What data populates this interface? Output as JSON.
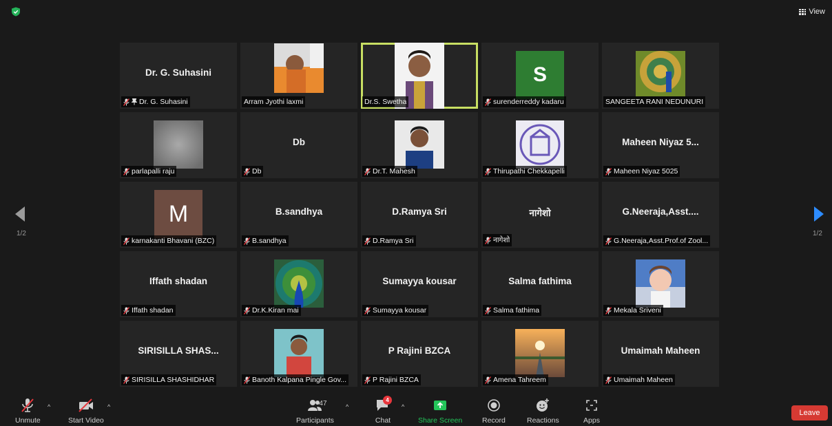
{
  "top": {
    "view_label": "View"
  },
  "colors": {
    "active_outline": "#c8df63",
    "leave": "#d63a33",
    "share": "#24c55a",
    "badge": "#e8373d"
  },
  "participants": [
    {
      "tile_name": "Dr. G. Suhasini",
      "label": "Dr. G. Suhasini",
      "muted": true,
      "pinned": true
    },
    {
      "label": "Arram Jyothi laxmi",
      "muted": false
    },
    {
      "label": "Dr.S. Swetha",
      "muted": false,
      "active_speaker": true
    },
    {
      "letter": "S",
      "label": "surenderreddy kadaru",
      "muted": true
    },
    {
      "label": "SANGEETA RANI NEDUNURI",
      "muted": false
    },
    {
      "label": "parlapalli raju",
      "muted": true
    },
    {
      "tile_name": "Db",
      "label": "Db",
      "muted": true
    },
    {
      "label": "Dr.T. Mahesh",
      "muted": true
    },
    {
      "label": "Thirupathi Chekkapelli",
      "muted": true
    },
    {
      "tile_name": "Maheen Niyaz 5...",
      "label": "Maheen Niyaz 5025",
      "muted": true
    },
    {
      "letter": "M",
      "label": "karnakanti Bhavani (BZC)",
      "muted": true
    },
    {
      "tile_name": "B.sandhya",
      "label": "B.sandhya",
      "muted": true
    },
    {
      "tile_name": "D.Ramya Sri",
      "label": "D.Ramya Sri",
      "muted": true
    },
    {
      "tile_name": "नागेशो",
      "label": "नागेशो",
      "muted": true
    },
    {
      "tile_name": "G.Neeraja,Asst....",
      "label": "G.Neeraja,Asst.Prof.of Zool...",
      "muted": true
    },
    {
      "tile_name": "Iffath shadan",
      "label": "Iffath shadan",
      "muted": true
    },
    {
      "label": "Dr.K.Kiran mai",
      "muted": true
    },
    {
      "tile_name": "Sumayya kousar",
      "label": "Sumayya kousar",
      "muted": true
    },
    {
      "tile_name": "Salma fathima",
      "label": "Salma fathima",
      "muted": true
    },
    {
      "label": "Mekala Sriveni",
      "muted": true
    },
    {
      "tile_name": "SIRISILLA SHAS...",
      "label": "SIRISILLA SHASHIDHAR",
      "muted": true
    },
    {
      "label": "Banoth Kalpana Pingle Gov...",
      "muted": true
    },
    {
      "tile_name": "P Rajini BZCA",
      "label": "P Rajini BZCA",
      "muted": true
    },
    {
      "label": "Amena Tahreem",
      "muted": true
    },
    {
      "tile_name": "Umaimah Maheen",
      "label": "Umaimah Maheen",
      "muted": true
    }
  ],
  "paging": {
    "left": "1/2",
    "right": "1/2"
  },
  "toolbar": {
    "unmute": "Unmute",
    "start_video": "Start Video",
    "participants": "Participants",
    "participants_count": "47",
    "chat": "Chat",
    "chat_badge": "4",
    "share_screen": "Share Screen",
    "record": "Record",
    "reactions": "Reactions",
    "apps": "Apps",
    "leave": "Leave"
  }
}
